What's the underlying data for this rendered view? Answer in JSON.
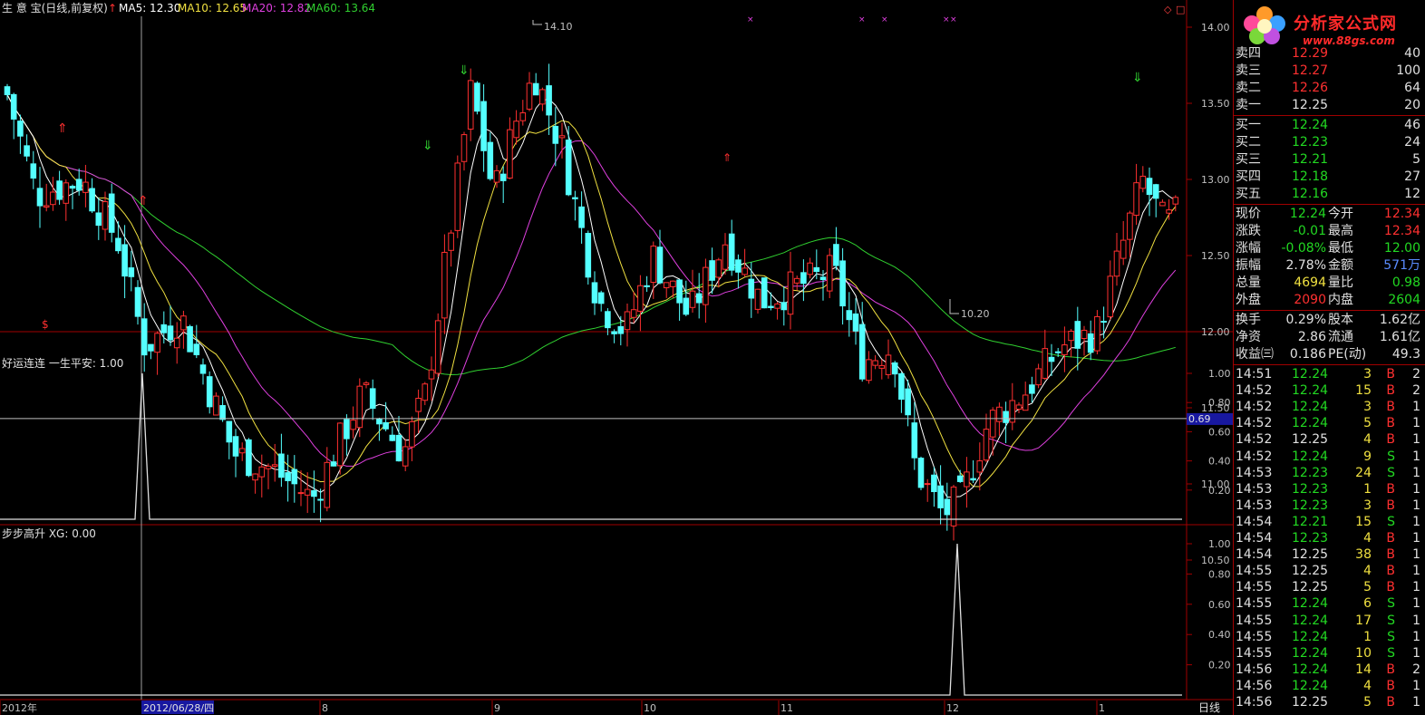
{
  "header": {
    "stock_name": "生 意 宝(日线,前复权)",
    "ma5": "MA5: 12.30",
    "ma10": "MA10: 12.65",
    "ma20": "MA20: 12.82",
    "ma60": "MA60: 13.64",
    "colors": {
      "ma5": "#ffffff",
      "ma10": "#f0e040",
      "ma20": "#e040e0",
      "ma60": "#30d030"
    }
  },
  "price_axis": {
    "ticks": [
      "14.00",
      "13.50",
      "13.00",
      "12.50",
      "12.00",
      "11.50",
      "11.00",
      "10.50"
    ],
    "range": [
      10.2,
      14.2
    ]
  },
  "annotations": {
    "high": "14.10",
    "low": "10.20"
  },
  "indicator1": {
    "title": "好运连连 一生平安: 1.00",
    "ticks": [
      "1.00",
      "0.80",
      "0.60",
      "0.40",
      "0.20"
    ],
    "marker": "0.69",
    "marker_value": 0.69
  },
  "indicator2": {
    "title": "步步高升 XG: 0.00",
    "ticks": [
      "1.00",
      "0.80",
      "0.60",
      "0.40",
      "0.20"
    ]
  },
  "date_axis": {
    "labels": [
      "2012年",
      "2012/06/28/四",
      "8",
      "9",
      "10",
      "11",
      "12",
      "1"
    ],
    "period_label": "日线"
  },
  "logo": {
    "text": "分析家公式网",
    "url": "www.88gs.com"
  },
  "quotes": {
    "sell": [
      {
        "label": "卖四",
        "price": "12.29",
        "vol": "40"
      },
      {
        "label": "卖三",
        "price": "12.27",
        "vol": "100"
      },
      {
        "label": "卖二",
        "price": "12.26",
        "vol": "64"
      },
      {
        "label": "卖一",
        "price": "12.25",
        "vol": "20"
      }
    ],
    "buy": [
      {
        "label": "买一",
        "price": "12.24",
        "vol": "46"
      },
      {
        "label": "买二",
        "price": "12.23",
        "vol": "24"
      },
      {
        "label": "买三",
        "price": "12.21",
        "vol": "5"
      },
      {
        "label": "买四",
        "price": "12.18",
        "vol": "27"
      },
      {
        "label": "买五",
        "price": "12.16",
        "vol": "12"
      }
    ]
  },
  "stats": [
    {
      "l1": "现价",
      "v1": "12.24",
      "c1": "g",
      "l2": "今开",
      "v2": "12.34",
      "c2": "r"
    },
    {
      "l1": "涨跌",
      "v1": "-0.01",
      "c1": "g",
      "l2": "最高",
      "v2": "12.34",
      "c2": "r"
    },
    {
      "l1": "涨幅",
      "v1": "-0.08%",
      "c1": "g",
      "l2": "最低",
      "v2": "12.00",
      "c2": "g"
    },
    {
      "l1": "振幅",
      "v1": "2.78%",
      "c1": "w",
      "l2": "金额",
      "v2": "571万",
      "c2": "b"
    },
    {
      "l1": "总量",
      "v1": "4694",
      "c1": "y",
      "l2": "量比",
      "v2": "0.98",
      "c2": "g"
    },
    {
      "l1": "外盘",
      "v1": "2090",
      "c1": "r",
      "l2": "内盘",
      "v2": "2604",
      "c2": "g"
    }
  ],
  "stats2": [
    {
      "l1": "换手",
      "v1": "0.29%",
      "l2": "股本",
      "v2": "1.62亿"
    },
    {
      "l1": "净资",
      "v1": "2.86",
      "l2": "流通",
      "v2": "1.61亿"
    },
    {
      "l1": "收益㈢",
      "v1": "0.186",
      "l2": "PE(动)",
      "v2": "49.3"
    }
  ],
  "ticks": [
    {
      "t": "14:51",
      "p": "12.24",
      "pc": "g",
      "v": "3",
      "s": "B",
      "n": "2"
    },
    {
      "t": "14:52",
      "p": "12.24",
      "pc": "g",
      "v": "15",
      "s": "B",
      "n": "2"
    },
    {
      "t": "14:52",
      "p": "12.24",
      "pc": "g",
      "v": "3",
      "s": "B",
      "n": "1"
    },
    {
      "t": "14:52",
      "p": "12.24",
      "pc": "g",
      "v": "5",
      "s": "B",
      "n": "1"
    },
    {
      "t": "14:52",
      "p": "12.25",
      "pc": "w",
      "v": "4",
      "s": "B",
      "n": "1"
    },
    {
      "t": "14:52",
      "p": "12.24",
      "pc": "g",
      "v": "9",
      "s": "S",
      "n": "1"
    },
    {
      "t": "14:53",
      "p": "12.23",
      "pc": "g",
      "v": "24",
      "s": "S",
      "n": "1"
    },
    {
      "t": "14:53",
      "p": "12.23",
      "pc": "g",
      "v": "1",
      "s": "B",
      "n": "1"
    },
    {
      "t": "14:53",
      "p": "12.23",
      "pc": "g",
      "v": "3",
      "s": "B",
      "n": "1"
    },
    {
      "t": "14:54",
      "p": "12.21",
      "pc": "g",
      "v": "15",
      "s": "S",
      "n": "1"
    },
    {
      "t": "14:54",
      "p": "12.23",
      "pc": "g",
      "v": "4",
      "s": "B",
      "n": "1"
    },
    {
      "t": "14:54",
      "p": "12.25",
      "pc": "w",
      "v": "38",
      "s": "B",
      "n": "1"
    },
    {
      "t": "14:55",
      "p": "12.25",
      "pc": "w",
      "v": "4",
      "s": "B",
      "n": "1"
    },
    {
      "t": "14:55",
      "p": "12.25",
      "pc": "w",
      "v": "5",
      "s": "B",
      "n": "1"
    },
    {
      "t": "14:55",
      "p": "12.24",
      "pc": "g",
      "v": "6",
      "s": "S",
      "n": "1"
    },
    {
      "t": "14:55",
      "p": "12.24",
      "pc": "g",
      "v": "17",
      "s": "S",
      "n": "1"
    },
    {
      "t": "14:55",
      "p": "12.24",
      "pc": "g",
      "v": "1",
      "s": "S",
      "n": "1"
    },
    {
      "t": "14:55",
      "p": "12.24",
      "pc": "g",
      "v": "10",
      "s": "S",
      "n": "1"
    },
    {
      "t": "14:56",
      "p": "12.24",
      "pc": "g",
      "v": "14",
      "s": "B",
      "n": "2"
    },
    {
      "t": "14:56",
      "p": "12.24",
      "pc": "g",
      "v": "4",
      "s": "B",
      "n": "1"
    },
    {
      "t": "14:56",
      "p": "12.25",
      "pc": "w",
      "v": "5",
      "s": "B",
      "n": "1"
    }
  ]
}
